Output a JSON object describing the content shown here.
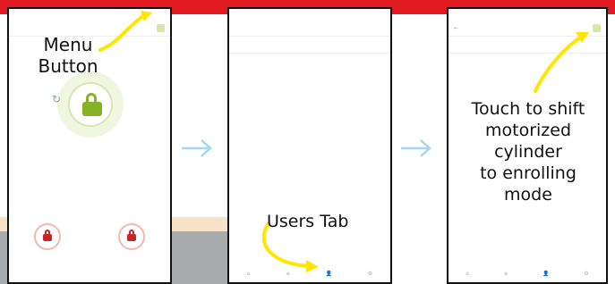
{
  "annotations": {
    "menu_button": "Menu\nButton",
    "users_tab": "Users Tab",
    "touch": "Touch to shift\nmotorized\ncylinder\nto enrolling\nmode"
  },
  "colors": {
    "brand_red": "#e21b23",
    "accent_green": "#87b227",
    "pointer_yellow": "#ffe600",
    "arrow_blue": "#a6d7f2"
  },
  "icons": {
    "lock_green": "lock-closed-icon",
    "lock_red": "lock-icon",
    "menu": "menu-icon",
    "arrow": "arrow-right-icon"
  }
}
